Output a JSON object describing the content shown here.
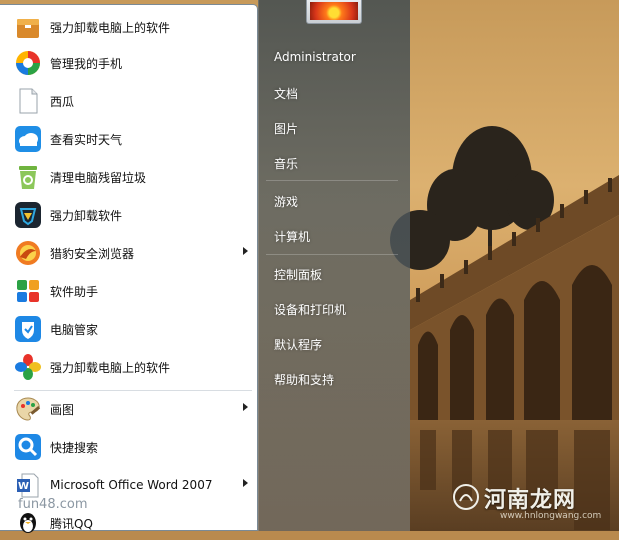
{
  "start_menu": {
    "programs": [
      {
        "label": "强力卸载电脑上的软件",
        "icon": "uninstaller-box-icon"
      },
      {
        "label": "管理我的手机",
        "icon": "phone-manager-icon"
      },
      {
        "label": "西瓜",
        "icon": "blank-document-icon"
      },
      {
        "label": "查看实时天气",
        "icon": "weather-cloud-icon"
      },
      {
        "label": "清理电脑残留垃圾",
        "icon": "recycle-bin-icon"
      },
      {
        "label": "强力卸载软件",
        "icon": "shield-uninstall-icon"
      },
      {
        "label": "猎豹安全浏览器",
        "icon": "cheetah-browser-icon"
      },
      {
        "label": "软件助手",
        "icon": "software-assistant-icon"
      },
      {
        "label": "电脑管家",
        "icon": "pc-manager-shield-icon"
      },
      {
        "label": "强力卸载电脑上的软件",
        "icon": "colorful-petals-icon"
      }
    ],
    "secondary": [
      {
        "label": "画图",
        "icon": "paint-palette-icon"
      },
      {
        "label": "快捷搜索",
        "icon": "magnifier-icon"
      },
      {
        "label": "Microsoft Office Word 2007",
        "icon": "word-document-icon"
      },
      {
        "label": "腾讯QQ",
        "icon": "qq-penguin-icon"
      }
    ],
    "right_pane": {
      "user": "Administrator",
      "links": [
        "文档",
        "图片",
        "音乐",
        "游戏",
        "计算机",
        "控制面板",
        "设备和打印机",
        "默认程序",
        "帮助和支持"
      ]
    }
  },
  "watermarks": {
    "left": "fun48.com",
    "right": "河南龙网",
    "right_sub": "www.hnlongwang.com"
  }
}
